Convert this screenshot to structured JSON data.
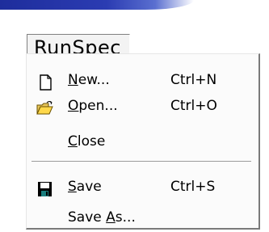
{
  "menu": {
    "title": "RunSpec",
    "items": [
      {
        "label_accel": "N",
        "label_rest": "ew...",
        "shortcut": "Ctrl+N",
        "icon": "new-file-icon"
      },
      {
        "label_accel": "O",
        "label_rest": "pen...",
        "shortcut": "Ctrl+O",
        "icon": "open-folder-icon"
      },
      {
        "label_accel": "C",
        "label_rest": "lose",
        "shortcut": "",
        "icon": ""
      },
      {
        "label_accel": "S",
        "label_rest": "ave",
        "shortcut": "Ctrl+S",
        "icon": "save-disk-icon"
      },
      {
        "label_before": "Save ",
        "label_accel": "A",
        "label_rest": "s...",
        "shortcut": "",
        "icon": ""
      }
    ]
  },
  "colors": {
    "titlebar": "#2b3cb2",
    "menu_bg": "#fbfbfb",
    "border_dark": "#7a7a7a"
  }
}
